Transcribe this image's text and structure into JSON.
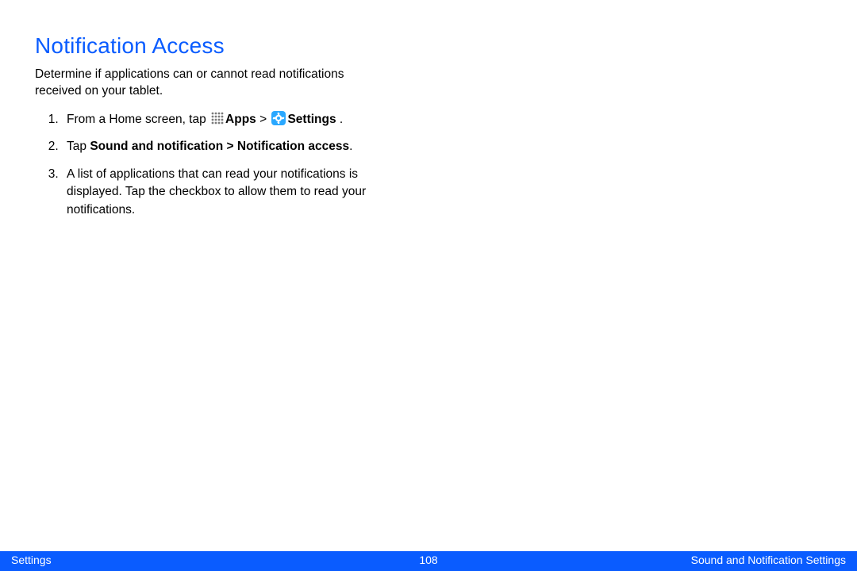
{
  "heading": "Notification Access",
  "intro": "Determine if applications can or cannot read notifications received on your tablet.",
  "steps": {
    "s1_prefix": "From a Home screen, tap ",
    "s1_apps": "Apps",
    "s1_gt": " > ",
    "s1_settings": "Settings",
    "s1_period": " .",
    "s2_prefix": "Tap ",
    "s2_bold": "Sound and notification > Notification access",
    "s2_period": ".",
    "s3": "A list of applications that can read your notifications is displayed. Tap the checkbox to allow them to read your notifications."
  },
  "footer": {
    "left": "Settings",
    "page": "108",
    "right": "Sound and Notification Settings"
  },
  "icons": {
    "apps": "apps-grid-icon",
    "settings": "settings-gear-icon"
  }
}
